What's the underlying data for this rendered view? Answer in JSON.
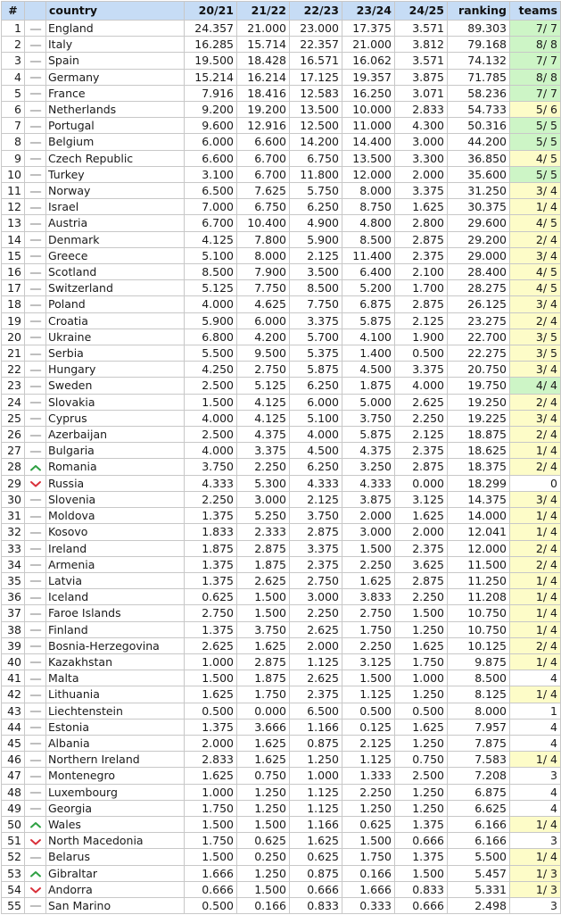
{
  "table": {
    "headers": {
      "rank": "#",
      "trend": "",
      "country": "country",
      "s2021": "20/21",
      "s2122": "21/22",
      "s2223": "22/23",
      "s2324": "23/24",
      "s2425": "24/25",
      "ranking": "ranking",
      "teams": "teams"
    },
    "colors": {
      "header_bg": "#c6dcf5",
      "teams_full": "#cdf5c6",
      "teams_partial": "#fdfcc8",
      "trend_up": "#2ea043",
      "trend_down": "#d9303a",
      "trend_same": "#aaaaaa"
    },
    "rows": [
      {
        "rank": "1",
        "trend": "same",
        "country": "England",
        "s2021": "24.357",
        "s2122": "21.000",
        "s2223": "23.000",
        "s2324": "17.375",
        "s2425": "3.571",
        "ranking": "89.303",
        "teams": "7/ 7",
        "teams_status": "full"
      },
      {
        "rank": "2",
        "trend": "same",
        "country": "Italy",
        "s2021": "16.285",
        "s2122": "15.714",
        "s2223": "22.357",
        "s2324": "21.000",
        "s2425": "3.812",
        "ranking": "79.168",
        "teams": "8/ 8",
        "teams_status": "full"
      },
      {
        "rank": "3",
        "trend": "same",
        "country": "Spain",
        "s2021": "19.500",
        "s2122": "18.428",
        "s2223": "16.571",
        "s2324": "16.062",
        "s2425": "3.571",
        "ranking": "74.132",
        "teams": "7/ 7",
        "teams_status": "full"
      },
      {
        "rank": "4",
        "trend": "same",
        "country": "Germany",
        "s2021": "15.214",
        "s2122": "16.214",
        "s2223": "17.125",
        "s2324": "19.357",
        "s2425": "3.875",
        "ranking": "71.785",
        "teams": "8/ 8",
        "teams_status": "full"
      },
      {
        "rank": "5",
        "trend": "same",
        "country": "France",
        "s2021": "7.916",
        "s2122": "18.416",
        "s2223": "12.583",
        "s2324": "16.250",
        "s2425": "3.071",
        "ranking": "58.236",
        "teams": "7/ 7",
        "teams_status": "full"
      },
      {
        "rank": "6",
        "trend": "same",
        "country": "Netherlands",
        "s2021": "9.200",
        "s2122": "19.200",
        "s2223": "13.500",
        "s2324": "10.000",
        "s2425": "2.833",
        "ranking": "54.733",
        "teams": "5/ 6",
        "teams_status": "partial"
      },
      {
        "rank": "7",
        "trend": "same",
        "country": "Portugal",
        "s2021": "9.600",
        "s2122": "12.916",
        "s2223": "12.500",
        "s2324": "11.000",
        "s2425": "4.300",
        "ranking": "50.316",
        "teams": "5/ 5",
        "teams_status": "full"
      },
      {
        "rank": "8",
        "trend": "same",
        "country": "Belgium",
        "s2021": "6.000",
        "s2122": "6.600",
        "s2223": "14.200",
        "s2324": "14.400",
        "s2425": "3.000",
        "ranking": "44.200",
        "teams": "5/ 5",
        "teams_status": "full"
      },
      {
        "rank": "9",
        "trend": "same",
        "country": "Czech Republic",
        "s2021": "6.600",
        "s2122": "6.700",
        "s2223": "6.750",
        "s2324": "13.500",
        "s2425": "3.300",
        "ranking": "36.850",
        "teams": "4/ 5",
        "teams_status": "partial"
      },
      {
        "rank": "10",
        "trend": "same",
        "country": "Turkey",
        "s2021": "3.100",
        "s2122": "6.700",
        "s2223": "11.800",
        "s2324": "12.000",
        "s2425": "2.000",
        "ranking": "35.600",
        "teams": "5/ 5",
        "teams_status": "full"
      },
      {
        "rank": "11",
        "trend": "same",
        "country": "Norway",
        "s2021": "6.500",
        "s2122": "7.625",
        "s2223": "5.750",
        "s2324": "8.000",
        "s2425": "3.375",
        "ranking": "31.250",
        "teams": "3/ 4",
        "teams_status": "partial"
      },
      {
        "rank": "12",
        "trend": "same",
        "country": "Israel",
        "s2021": "7.000",
        "s2122": "6.750",
        "s2223": "6.250",
        "s2324": "8.750",
        "s2425": "1.625",
        "ranking": "30.375",
        "teams": "1/ 4",
        "teams_status": "partial"
      },
      {
        "rank": "13",
        "trend": "same",
        "country": "Austria",
        "s2021": "6.700",
        "s2122": "10.400",
        "s2223": "4.900",
        "s2324": "4.800",
        "s2425": "2.800",
        "ranking": "29.600",
        "teams": "4/ 5",
        "teams_status": "partial"
      },
      {
        "rank": "14",
        "trend": "same",
        "country": "Denmark",
        "s2021": "4.125",
        "s2122": "7.800",
        "s2223": "5.900",
        "s2324": "8.500",
        "s2425": "2.875",
        "ranking": "29.200",
        "teams": "2/ 4",
        "teams_status": "partial"
      },
      {
        "rank": "15",
        "trend": "same",
        "country": "Greece",
        "s2021": "5.100",
        "s2122": "8.000",
        "s2223": "2.125",
        "s2324": "11.400",
        "s2425": "2.375",
        "ranking": "29.000",
        "teams": "3/ 4",
        "teams_status": "partial"
      },
      {
        "rank": "16",
        "trend": "same",
        "country": "Scotland",
        "s2021": "8.500",
        "s2122": "7.900",
        "s2223": "3.500",
        "s2324": "6.400",
        "s2425": "2.100",
        "ranking": "28.400",
        "teams": "4/ 5",
        "teams_status": "partial"
      },
      {
        "rank": "17",
        "trend": "same",
        "country": "Switzerland",
        "s2021": "5.125",
        "s2122": "7.750",
        "s2223": "8.500",
        "s2324": "5.200",
        "s2425": "1.700",
        "ranking": "28.275",
        "teams": "4/ 5",
        "teams_status": "partial"
      },
      {
        "rank": "18",
        "trend": "same",
        "country": "Poland",
        "s2021": "4.000",
        "s2122": "4.625",
        "s2223": "7.750",
        "s2324": "6.875",
        "s2425": "2.875",
        "ranking": "26.125",
        "teams": "3/ 4",
        "teams_status": "partial"
      },
      {
        "rank": "19",
        "trend": "same",
        "country": "Croatia",
        "s2021": "5.900",
        "s2122": "6.000",
        "s2223": "3.375",
        "s2324": "5.875",
        "s2425": "2.125",
        "ranking": "23.275",
        "teams": "2/ 4",
        "teams_status": "partial"
      },
      {
        "rank": "20",
        "trend": "same",
        "country": "Ukraine",
        "s2021": "6.800",
        "s2122": "4.200",
        "s2223": "5.700",
        "s2324": "4.100",
        "s2425": "1.900",
        "ranking": "22.700",
        "teams": "3/ 5",
        "teams_status": "partial"
      },
      {
        "rank": "21",
        "trend": "same",
        "country": "Serbia",
        "s2021": "5.500",
        "s2122": "9.500",
        "s2223": "5.375",
        "s2324": "1.400",
        "s2425": "0.500",
        "ranking": "22.275",
        "teams": "3/ 5",
        "teams_status": "partial"
      },
      {
        "rank": "22",
        "trend": "same",
        "country": "Hungary",
        "s2021": "4.250",
        "s2122": "2.750",
        "s2223": "5.875",
        "s2324": "4.500",
        "s2425": "3.375",
        "ranking": "20.750",
        "teams": "3/ 4",
        "teams_status": "partial"
      },
      {
        "rank": "23",
        "trend": "same",
        "country": "Sweden",
        "s2021": "2.500",
        "s2122": "5.125",
        "s2223": "6.250",
        "s2324": "1.875",
        "s2425": "4.000",
        "ranking": "19.750",
        "teams": "4/ 4",
        "teams_status": "full"
      },
      {
        "rank": "24",
        "trend": "same",
        "country": "Slovakia",
        "s2021": "1.500",
        "s2122": "4.125",
        "s2223": "6.000",
        "s2324": "5.000",
        "s2425": "2.625",
        "ranking": "19.250",
        "teams": "2/ 4",
        "teams_status": "partial"
      },
      {
        "rank": "25",
        "trend": "same",
        "country": "Cyprus",
        "s2021": "4.000",
        "s2122": "4.125",
        "s2223": "5.100",
        "s2324": "3.750",
        "s2425": "2.250",
        "ranking": "19.225",
        "teams": "3/ 4",
        "teams_status": "partial"
      },
      {
        "rank": "26",
        "trend": "same",
        "country": "Azerbaijan",
        "s2021": "2.500",
        "s2122": "4.375",
        "s2223": "4.000",
        "s2324": "5.875",
        "s2425": "2.125",
        "ranking": "18.875",
        "teams": "2/ 4",
        "teams_status": "partial"
      },
      {
        "rank": "27",
        "trend": "same",
        "country": "Bulgaria",
        "s2021": "4.000",
        "s2122": "3.375",
        "s2223": "4.500",
        "s2324": "4.375",
        "s2425": "2.375",
        "ranking": "18.625",
        "teams": "1/ 4",
        "teams_status": "partial"
      },
      {
        "rank": "28",
        "trend": "up",
        "country": "Romania",
        "s2021": "3.750",
        "s2122": "2.250",
        "s2223": "6.250",
        "s2324": "3.250",
        "s2425": "2.875",
        "ranking": "18.375",
        "teams": "2/ 4",
        "teams_status": "partial"
      },
      {
        "rank": "29",
        "trend": "down",
        "country": "Russia",
        "s2021": "4.333",
        "s2122": "5.300",
        "s2223": "4.333",
        "s2324": "4.333",
        "s2425": "0.000",
        "ranking": "18.299",
        "teams": "0",
        "teams_status": "none"
      },
      {
        "rank": "30",
        "trend": "same",
        "country": "Slovenia",
        "s2021": "2.250",
        "s2122": "3.000",
        "s2223": "2.125",
        "s2324": "3.875",
        "s2425": "3.125",
        "ranking": "14.375",
        "teams": "3/ 4",
        "teams_status": "partial"
      },
      {
        "rank": "31",
        "trend": "same",
        "country": "Moldova",
        "s2021": "1.375",
        "s2122": "5.250",
        "s2223": "3.750",
        "s2324": "2.000",
        "s2425": "1.625",
        "ranking": "14.000",
        "teams": "1/ 4",
        "teams_status": "partial"
      },
      {
        "rank": "32",
        "trend": "same",
        "country": "Kosovo",
        "s2021": "1.833",
        "s2122": "2.333",
        "s2223": "2.875",
        "s2324": "3.000",
        "s2425": "2.000",
        "ranking": "12.041",
        "teams": "1/ 4",
        "teams_status": "partial"
      },
      {
        "rank": "33",
        "trend": "same",
        "country": "Ireland",
        "s2021": "1.875",
        "s2122": "2.875",
        "s2223": "3.375",
        "s2324": "1.500",
        "s2425": "2.375",
        "ranking": "12.000",
        "teams": "2/ 4",
        "teams_status": "partial"
      },
      {
        "rank": "34",
        "trend": "same",
        "country": "Armenia",
        "s2021": "1.375",
        "s2122": "1.875",
        "s2223": "2.375",
        "s2324": "2.250",
        "s2425": "3.625",
        "ranking": "11.500",
        "teams": "2/ 4",
        "teams_status": "partial"
      },
      {
        "rank": "35",
        "trend": "same",
        "country": "Latvia",
        "s2021": "1.375",
        "s2122": "2.625",
        "s2223": "2.750",
        "s2324": "1.625",
        "s2425": "2.875",
        "ranking": "11.250",
        "teams": "1/ 4",
        "teams_status": "partial"
      },
      {
        "rank": "36",
        "trend": "same",
        "country": "Iceland",
        "s2021": "0.625",
        "s2122": "1.500",
        "s2223": "3.000",
        "s2324": "3.833",
        "s2425": "2.250",
        "ranking": "11.208",
        "teams": "1/ 4",
        "teams_status": "partial"
      },
      {
        "rank": "37",
        "trend": "same",
        "country": "Faroe Islands",
        "s2021": "2.750",
        "s2122": "1.500",
        "s2223": "2.250",
        "s2324": "2.750",
        "s2425": "1.500",
        "ranking": "10.750",
        "teams": "1/ 4",
        "teams_status": "partial"
      },
      {
        "rank": "38",
        "trend": "same",
        "country": "Finland",
        "s2021": "1.375",
        "s2122": "3.750",
        "s2223": "2.625",
        "s2324": "1.750",
        "s2425": "1.250",
        "ranking": "10.750",
        "teams": "1/ 4",
        "teams_status": "partial"
      },
      {
        "rank": "39",
        "trend": "same",
        "country": "Bosnia-Herzegovina",
        "s2021": "2.625",
        "s2122": "1.625",
        "s2223": "2.000",
        "s2324": "2.250",
        "s2425": "1.625",
        "ranking": "10.125",
        "teams": "2/ 4",
        "teams_status": "partial"
      },
      {
        "rank": "40",
        "trend": "same",
        "country": "Kazakhstan",
        "s2021": "1.000",
        "s2122": "2.875",
        "s2223": "1.125",
        "s2324": "3.125",
        "s2425": "1.750",
        "ranking": "9.875",
        "teams": "1/ 4",
        "teams_status": "partial"
      },
      {
        "rank": "41",
        "trend": "same",
        "country": "Malta",
        "s2021": "1.500",
        "s2122": "1.875",
        "s2223": "2.625",
        "s2324": "1.500",
        "s2425": "1.000",
        "ranking": "8.500",
        "teams": "4",
        "teams_status": "none"
      },
      {
        "rank": "42",
        "trend": "same",
        "country": "Lithuania",
        "s2021": "1.625",
        "s2122": "1.750",
        "s2223": "2.375",
        "s2324": "1.125",
        "s2425": "1.250",
        "ranking": "8.125",
        "teams": "1/ 4",
        "teams_status": "partial"
      },
      {
        "rank": "43",
        "trend": "same",
        "country": "Liechtenstein",
        "s2021": "0.500",
        "s2122": "0.000",
        "s2223": "6.500",
        "s2324": "0.500",
        "s2425": "0.500",
        "ranking": "8.000",
        "teams": "1",
        "teams_status": "none"
      },
      {
        "rank": "44",
        "trend": "same",
        "country": "Estonia",
        "s2021": "1.375",
        "s2122": "3.666",
        "s2223": "1.166",
        "s2324": "0.125",
        "s2425": "1.625",
        "ranking": "7.957",
        "teams": "4",
        "teams_status": "none"
      },
      {
        "rank": "45",
        "trend": "same",
        "country": "Albania",
        "s2021": "2.000",
        "s2122": "1.625",
        "s2223": "0.875",
        "s2324": "2.125",
        "s2425": "1.250",
        "ranking": "7.875",
        "teams": "4",
        "teams_status": "none"
      },
      {
        "rank": "46",
        "trend": "same",
        "country": "Northern Ireland",
        "s2021": "2.833",
        "s2122": "1.625",
        "s2223": "1.250",
        "s2324": "1.125",
        "s2425": "0.750",
        "ranking": "7.583",
        "teams": "1/ 4",
        "teams_status": "partial"
      },
      {
        "rank": "47",
        "trend": "same",
        "country": "Montenegro",
        "s2021": "1.625",
        "s2122": "0.750",
        "s2223": "1.000",
        "s2324": "1.333",
        "s2425": "2.500",
        "ranking": "7.208",
        "teams": "3",
        "teams_status": "none"
      },
      {
        "rank": "48",
        "trend": "same",
        "country": "Luxembourg",
        "s2021": "1.000",
        "s2122": "1.250",
        "s2223": "1.125",
        "s2324": "2.250",
        "s2425": "1.250",
        "ranking": "6.875",
        "teams": "4",
        "teams_status": "none"
      },
      {
        "rank": "49",
        "trend": "same",
        "country": "Georgia",
        "s2021": "1.750",
        "s2122": "1.250",
        "s2223": "1.125",
        "s2324": "1.250",
        "s2425": "1.250",
        "ranking": "6.625",
        "teams": "4",
        "teams_status": "none"
      },
      {
        "rank": "50",
        "trend": "up",
        "country": "Wales",
        "s2021": "1.500",
        "s2122": "1.500",
        "s2223": "1.166",
        "s2324": "0.625",
        "s2425": "1.375",
        "ranking": "6.166",
        "teams": "1/ 4",
        "teams_status": "partial"
      },
      {
        "rank": "51",
        "trend": "down",
        "country": "North Macedonia",
        "s2021": "1.750",
        "s2122": "0.625",
        "s2223": "1.625",
        "s2324": "1.500",
        "s2425": "0.666",
        "ranking": "6.166",
        "teams": "3",
        "teams_status": "none"
      },
      {
        "rank": "52",
        "trend": "same",
        "country": "Belarus",
        "s2021": "1.500",
        "s2122": "0.250",
        "s2223": "0.625",
        "s2324": "1.750",
        "s2425": "1.375",
        "ranking": "5.500",
        "teams": "1/ 4",
        "teams_status": "partial"
      },
      {
        "rank": "53",
        "trend": "up",
        "country": "Gibraltar",
        "s2021": "1.666",
        "s2122": "1.250",
        "s2223": "0.875",
        "s2324": "0.166",
        "s2425": "1.500",
        "ranking": "5.457",
        "teams": "1/ 3",
        "teams_status": "partial"
      },
      {
        "rank": "54",
        "trend": "down",
        "country": "Andorra",
        "s2021": "0.666",
        "s2122": "1.500",
        "s2223": "0.666",
        "s2324": "1.666",
        "s2425": "0.833",
        "ranking": "5.331",
        "teams": "1/ 3",
        "teams_status": "partial"
      },
      {
        "rank": "55",
        "trend": "same",
        "country": "San Marino",
        "s2021": "0.500",
        "s2122": "0.166",
        "s2223": "0.833",
        "s2324": "0.333",
        "s2425": "0.666",
        "ranking": "2.498",
        "teams": "3",
        "teams_status": "none"
      }
    ]
  }
}
